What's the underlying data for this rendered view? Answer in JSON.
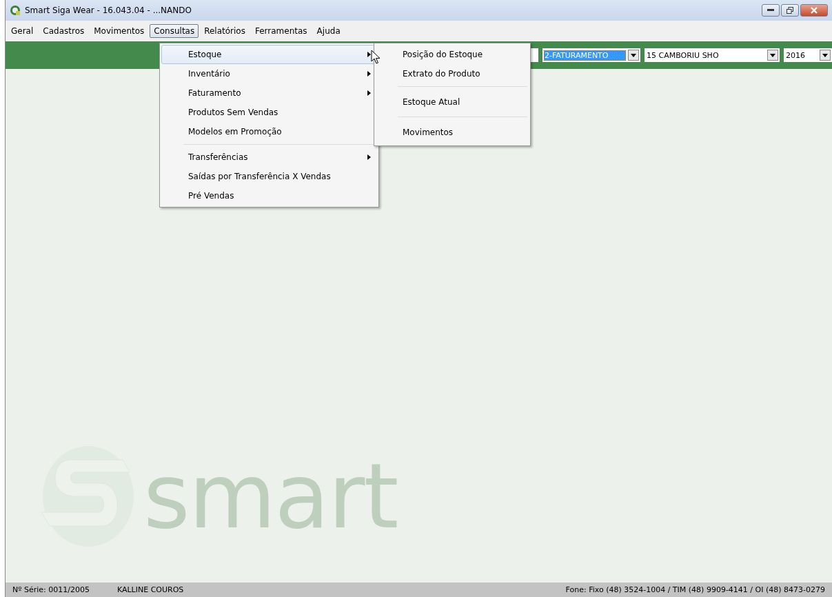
{
  "window": {
    "title": "Smart Siga Wear - 16.043.04 - ...NANDO"
  },
  "menu_bar": [
    {
      "label": "Geral",
      "selected": false
    },
    {
      "label": "Cadastros",
      "selected": false
    },
    {
      "label": "Movimentos",
      "selected": false
    },
    {
      "label": "Consultas",
      "selected": true
    },
    {
      "label": "Relatórios",
      "selected": false
    },
    {
      "label": "Ferramentas",
      "selected": false
    },
    {
      "label": "Ajuda",
      "selected": false
    }
  ],
  "dropdown_menu": [
    {
      "kind": "item",
      "label": "Estoque",
      "submenu": true,
      "selected": true
    },
    {
      "kind": "item",
      "label": "Inventário",
      "submenu": true,
      "selected": false
    },
    {
      "kind": "item",
      "label": "Faturamento",
      "submenu": true,
      "selected": false
    },
    {
      "kind": "item",
      "label": "Produtos Sem Vendas",
      "submenu": false,
      "selected": false
    },
    {
      "kind": "item",
      "label": "Modelos em Promoção",
      "submenu": false,
      "selected": false
    },
    {
      "kind": "separator"
    },
    {
      "kind": "item",
      "label": "Transferências",
      "submenu": true,
      "selected": false
    },
    {
      "kind": "item",
      "label": "Saídas por Transferência X Vendas",
      "submenu": false,
      "selected": false
    },
    {
      "kind": "item",
      "label": "Pré Vendas",
      "submenu": false,
      "selected": false
    }
  ],
  "submenu": [
    {
      "kind": "item",
      "label": "Posição do Estoque"
    },
    {
      "kind": "item",
      "label": "Extrato do Produto"
    },
    {
      "kind": "separator"
    },
    {
      "kind": "item",
      "label": "Estoque Atual"
    },
    {
      "kind": "separator"
    },
    {
      "kind": "item",
      "label": "Movimentos"
    }
  ],
  "toolbar": {
    "combos": [
      {
        "value": "2-FATURAMENTO",
        "selected": true
      },
      {
        "value": "15 CAMBORIU SHO",
        "selected": false
      },
      {
        "value": "2016",
        "selected": false
      }
    ]
  },
  "background_logo": {
    "text": "smart"
  },
  "status_bar": {
    "serial": "Nº Série: 0011/2005",
    "company": "KALLINE COUROS",
    "phone": "Fone: Fixo (48) 3524-1004 / TIM (48) 9909-4141 / OI (48) 8473-0279"
  }
}
